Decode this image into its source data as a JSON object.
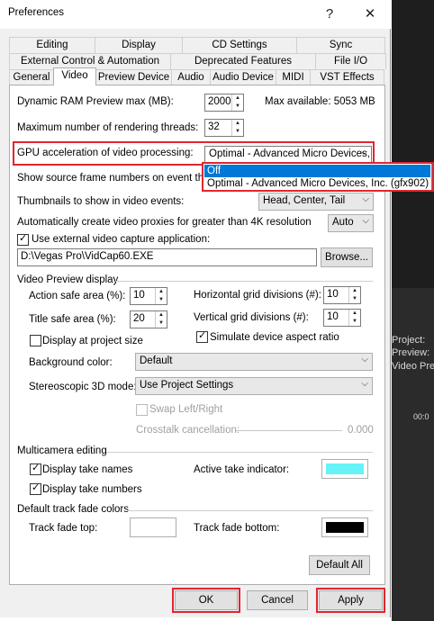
{
  "window": {
    "title": "Preferences",
    "help_glyph": "?",
    "close_glyph": "✕"
  },
  "tabs_row1": [
    "Editing",
    "Display",
    "CD Settings",
    "Sync"
  ],
  "tabs_row2": [
    "External Control & Automation",
    "Deprecated Features",
    "File I/O"
  ],
  "tabs_row3": [
    "General",
    "Video",
    "Preview Device",
    "Audio",
    "Audio Device",
    "MIDI",
    "VST Effects"
  ],
  "active_tab": "Video",
  "video": {
    "ram_preview_label": "Dynamic RAM Preview max (MB):",
    "ram_preview_value": "2000",
    "ram_available": "Max available: 5053 MB",
    "threads_label": "Maximum number of rendering threads:",
    "threads_value": "32",
    "gpu_label": "GPU acceleration of video processing:",
    "gpu_value": "Optimal - Advanced Micro Devices,",
    "gpu_options": [
      "Off",
      "Optimal - Advanced Micro Devices, Inc. (gfx902)"
    ],
    "source_frames_label": "Show source frame numbers on event thum",
    "thumbnails_label": "Thumbnails to show in video events:",
    "thumbnails_value": "Head, Center, Tail",
    "proxies_label": "Automatically create video proxies for greater than 4K resolution",
    "proxies_value": "Auto",
    "external_capture_label": "Use external video capture application:",
    "external_capture_checked": true,
    "capture_path": "D:\\Vegas Pro\\VidCap60.EXE",
    "browse_label": "Browse..."
  },
  "preview_display": {
    "section_label": "Video Preview display",
    "action_safe_label": "Action safe area (%):",
    "action_safe_value": "10",
    "title_safe_label": "Title safe area (%):",
    "title_safe_value": "20",
    "h_grid_label": "Horizontal grid divisions (#):",
    "h_grid_value": "10",
    "v_grid_label": "Vertical grid divisions (#):",
    "v_grid_value": "10",
    "display_project_size_label": "Display at project size",
    "display_project_size_checked": false,
    "simulate_aspect_label": "Simulate device aspect ratio",
    "simulate_aspect_checked": true,
    "bg_color_label": "Background color:",
    "bg_color_value": "Default",
    "stereo_label": "Stereoscopic 3D mode:",
    "stereo_value": "Use Project Settings",
    "swap_label": "Swap Left/Right",
    "crosstalk_label": "Crosstalk cancellation:",
    "crosstalk_value": "0.000"
  },
  "multicam": {
    "section_label": "Multicamera editing",
    "take_names_label": "Display take names",
    "take_numbers_label": "Display take numbers",
    "active_take_label": "Active take indicator:",
    "active_take_color": "#66f3f8"
  },
  "fade": {
    "section_label": "Default track fade colors",
    "top_label": "Track fade top:",
    "top_color": "#ffffff",
    "bottom_label": "Track fade bottom:",
    "bottom_color": "#000000"
  },
  "buttons": {
    "default_all": "Default All",
    "ok": "OK",
    "cancel": "Cancel",
    "apply": "Apply"
  },
  "background_app": {
    "project": "Project:",
    "preview": "Preview:",
    "video_pre": "Video Pre",
    "timecode": "00:0"
  },
  "colors": {
    "highlight": "#e0262f",
    "selection": "#0078d7"
  }
}
